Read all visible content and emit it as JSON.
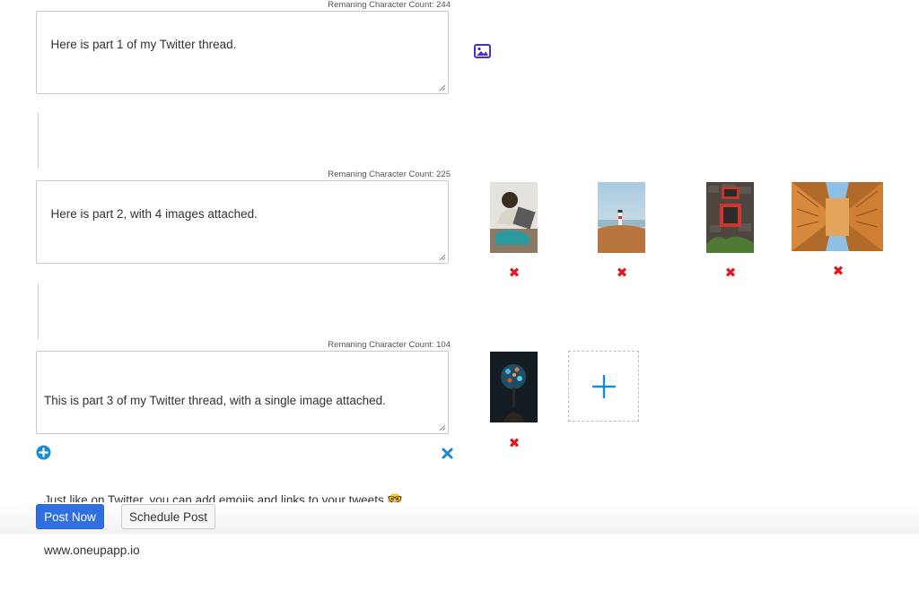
{
  "tweets": [
    {
      "remaining_label": "Remaning Character Count: 244",
      "text": "Here is part 1 of my Twitter thread."
    },
    {
      "remaining_label": "Remaning Character Count: 225",
      "text": "Here is part 2, with 4 images attached."
    },
    {
      "remaining_label": "Remaning Character Count: 104",
      "text_line1": "This is part 3 of my Twitter thread, with a single image attached.",
      "text_line2": "Just like on Twitter, you can add emojis and links to your tweets 🤓",
      "text_line3": "www.oneupapp.io"
    }
  ],
  "icons": {
    "add_image": "image-icon",
    "add_tweet": "plus-circle-icon",
    "delete_tweet": "close-icon",
    "remove_image": "close-icon",
    "add_image_tile": "plus-icon"
  },
  "buttons": {
    "post_now": "Post Now",
    "schedule_post": "Schedule Post"
  },
  "colors": {
    "primary": "#2f6fdf",
    "remove": "#e8141d",
    "accent_blue": "#1a8ad4",
    "image_icon": "#4b2ad8"
  }
}
